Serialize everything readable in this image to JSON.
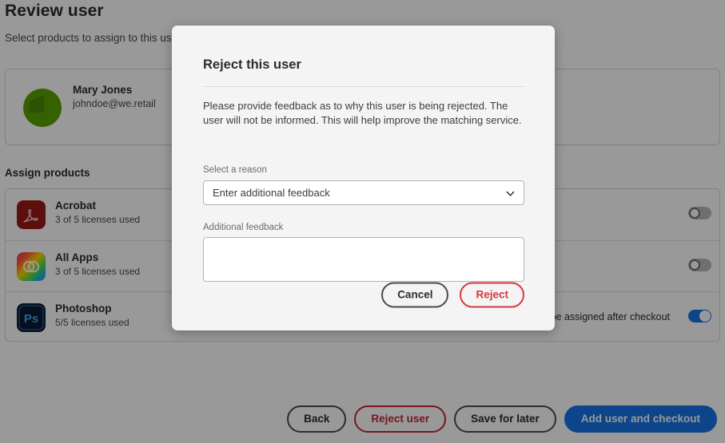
{
  "page": {
    "title": "Review user",
    "subtitle": "Select products to assign to this user",
    "assign_title": "Assign products"
  },
  "user": {
    "name": "Mary Jones",
    "email": "johndoe@we.retail",
    "avatar_color": "#5aa203"
  },
  "products": [
    {
      "name": "Acrobat",
      "licenses": "3 of 5 licenses used",
      "icon": "acrobat-icon",
      "toggle_on": false,
      "note": ""
    },
    {
      "name": "All Apps",
      "licenses": "3 of 5 licenses used",
      "icon": "all-apps-icon",
      "toggle_on": false,
      "note": ""
    },
    {
      "name": "Photoshop",
      "licenses": "5/5 licenses used",
      "icon": "photoshop-icon",
      "toggle_on": true,
      "note": "ill be assigned after checkout"
    }
  ],
  "actions": {
    "back": "Back",
    "reject_user": "Reject user",
    "save_for_later": "Save for later",
    "add_user_and_checkout": "Add user and checkout"
  },
  "modal": {
    "title": "Reject this user",
    "body": "Please provide feedback as to why this user is being rejected. The user will not be informed. This will help improve the matching service.",
    "reason_label": "Select a reason",
    "reason_value": "Enter additional feedback",
    "feedback_label": "Additional feedback",
    "feedback_value": "",
    "cancel": "Cancel",
    "reject": "Reject"
  },
  "colors": {
    "accent_blue": "#1473e6",
    "danger_red": "#d7373f",
    "reject_outline": "#c9252d"
  }
}
